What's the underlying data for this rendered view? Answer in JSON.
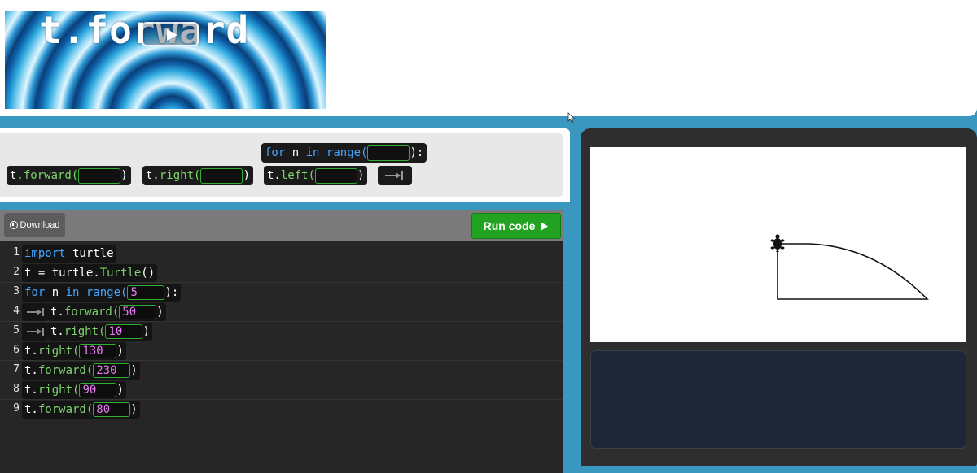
{
  "video": {
    "title": "t.forward"
  },
  "palette": {
    "loop_block": {
      "keyword_for": "for",
      "var": "n",
      "keyword_in": "in",
      "func": "range(",
      "close": "):"
    },
    "forward_block": {
      "prefix": "t.",
      "func": "forward(",
      "close": ")"
    },
    "right_block": {
      "prefix": "t.",
      "func": "right(",
      "close": ")"
    },
    "left_block": {
      "prefix": "t.",
      "func": "left(",
      "close": ")"
    }
  },
  "editor": {
    "download_label": "Download",
    "run_label": "Run code",
    "lines": [
      {
        "num": "1",
        "parts": [
          "import",
          " turtle"
        ]
      },
      {
        "num": "2",
        "parts": [
          "t = turtle.",
          "Turtle",
          "()"
        ]
      },
      {
        "num": "3",
        "parts": [
          "for",
          " n ",
          "in",
          " range(",
          "5",
          "):"
        ]
      },
      {
        "num": "4",
        "parts": [
          "t.",
          "forward(",
          "50",
          ")"
        ]
      },
      {
        "num": "5",
        "parts": [
          "t.",
          "right(",
          "10",
          ")"
        ]
      },
      {
        "num": "6",
        "parts": [
          "t.",
          "right(",
          "130",
          ")"
        ]
      },
      {
        "num": "7",
        "parts": [
          "t.",
          "forward(",
          "230",
          ")"
        ]
      },
      {
        "num": "8",
        "parts": [
          "t.",
          "right(",
          "90",
          ")"
        ]
      },
      {
        "num": "9",
        "parts": [
          "t.",
          "forward(",
          "80",
          ")"
        ]
      }
    ]
  },
  "colors": {
    "keyword": "#44a7ff",
    "function": "#7fd36e",
    "number": "#e87cf2",
    "slot_border": "#2fb02f",
    "run_button": "#21a321",
    "page_background": "#3a98c0"
  },
  "icons": {
    "play": "play-icon",
    "download": "download-icon",
    "run": "triangle-right-icon",
    "indent": "tab-arrow-icon",
    "turtle": "turtle-icon"
  }
}
